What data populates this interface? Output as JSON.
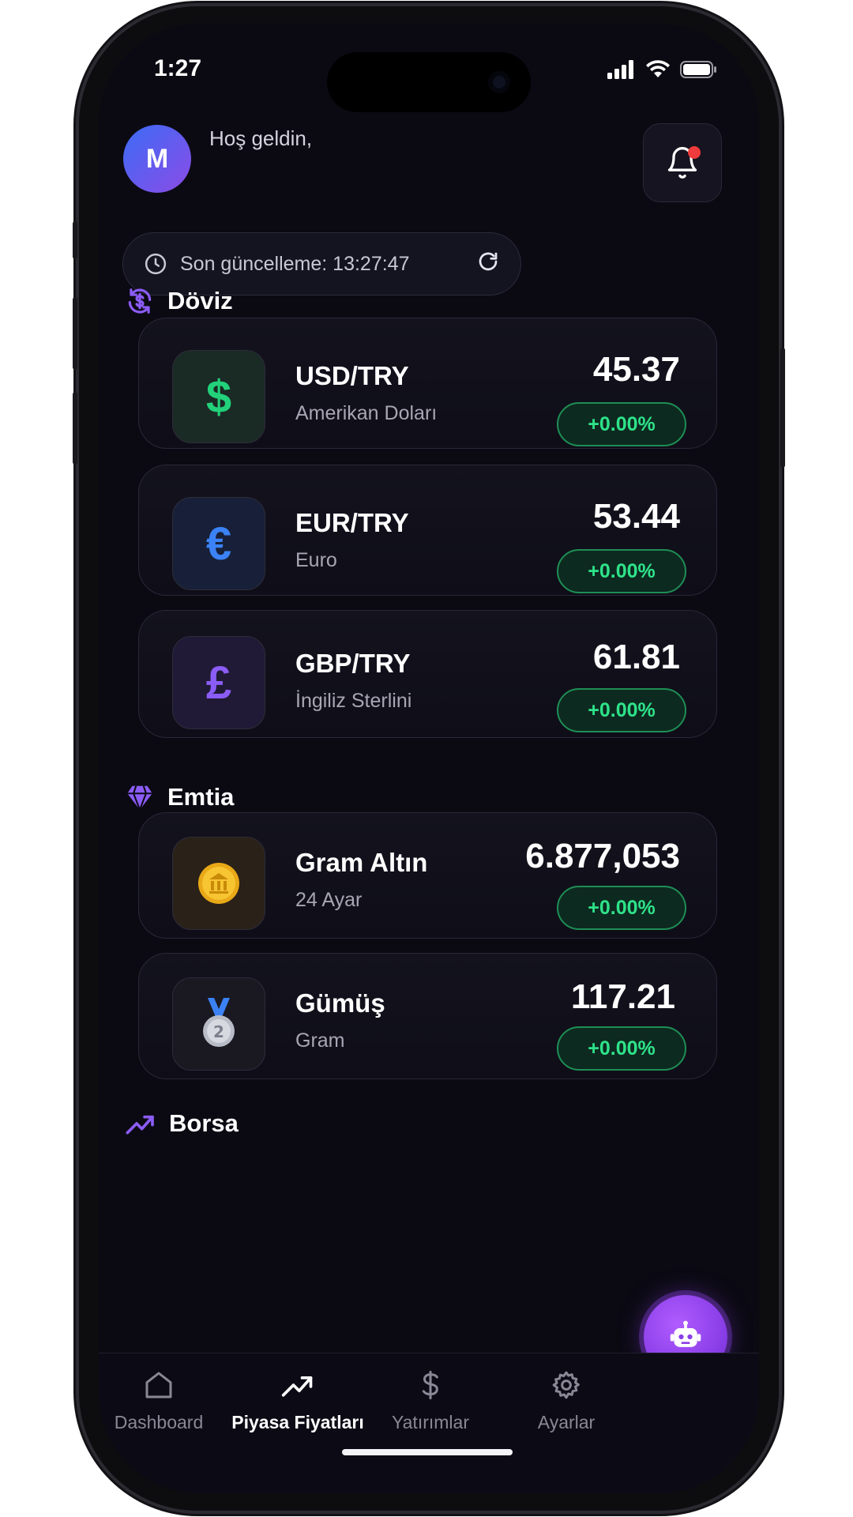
{
  "status_bar": {
    "time": "1:27"
  },
  "header": {
    "avatar_initial": "M",
    "greeting": "Hoş geldin,"
  },
  "update": {
    "label": "Son güncelleme: 13:27:47"
  },
  "sections": {
    "doviz": "Döviz",
    "emtia": "Emtia",
    "borsa": "Borsa"
  },
  "currencies": [
    {
      "name": "USD/TRY",
      "sub": "Amerikan Doları",
      "price": "45.37",
      "change": "+0.00%",
      "symbol": "$",
      "color": "#22d17a"
    },
    {
      "name": "EUR/TRY",
      "sub": "Euro",
      "price": "53.44",
      "change": "+0.00%",
      "symbol": "€",
      "color": "#3b82f6"
    },
    {
      "name": "GBP/TRY",
      "sub": "İngiliz Sterlini",
      "price": "61.81",
      "change": "+0.00%",
      "symbol": "£",
      "color": "#8b5cf6"
    }
  ],
  "commodities": [
    {
      "name": "Gram Altın",
      "sub": "24 Ayar",
      "price": "6.877,053",
      "change": "+0.00%",
      "icon": "gold-coin-icon"
    },
    {
      "name": "Gümüş",
      "sub": "Gram",
      "price": "117.21",
      "change": "+0.00%",
      "icon": "silver-medal-icon"
    }
  ],
  "nav": [
    {
      "label": "Dashboard",
      "icon": "home-icon"
    },
    {
      "label": "Piyasa Fiyatları",
      "icon": "trending-icon",
      "active": true
    },
    {
      "label": "Yatırımlar",
      "icon": "dollar-icon"
    },
    {
      "label": "Ayarlar",
      "icon": "gear-icon"
    }
  ],
  "colors": {
    "accent": "#8b3fe8",
    "positive": "#2ee38a",
    "background": "#0b0a13"
  }
}
